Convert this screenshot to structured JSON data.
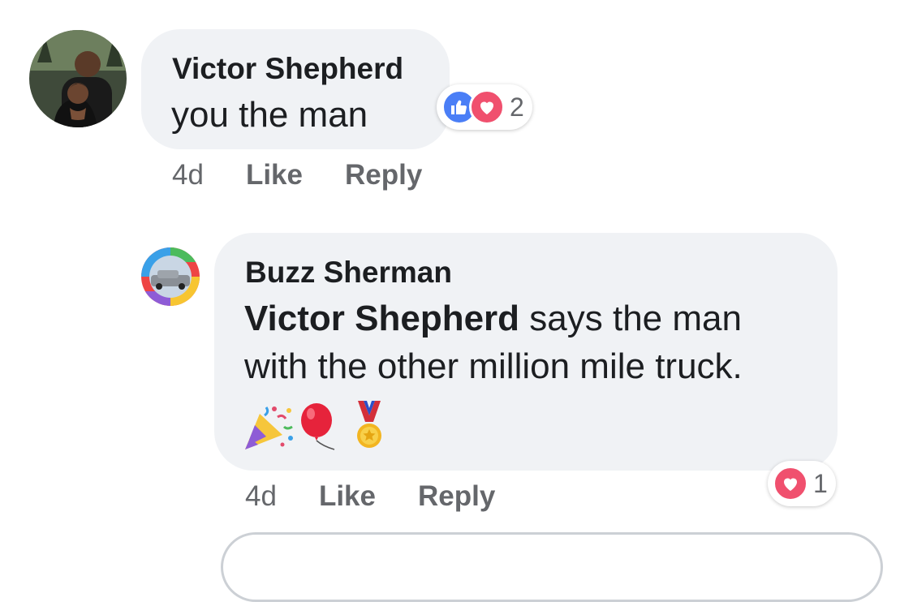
{
  "comments": [
    {
      "author": "Victor Shepherd",
      "text": "you the man",
      "time": "4d",
      "like_label": "Like",
      "reply_label": "Reply",
      "reactions": {
        "types": [
          "like",
          "love"
        ],
        "count": "2"
      }
    },
    {
      "author": "Buzz Sherman",
      "mention": "Victor Shepherd",
      "text_line1": " says the man",
      "text_line2": "with the other million mile truck.",
      "emojis": [
        "party-popper",
        "balloon",
        "medal"
      ],
      "time": "4d",
      "like_label": "Like",
      "reply_label": "Reply",
      "reactions": {
        "types": [
          "love"
        ],
        "count": "1"
      }
    }
  ],
  "colors": {
    "bubble": "#f0f2f5",
    "like_blue": "#4a7ef6",
    "love_red": "#f0506e",
    "meta_gray": "#65676b"
  }
}
